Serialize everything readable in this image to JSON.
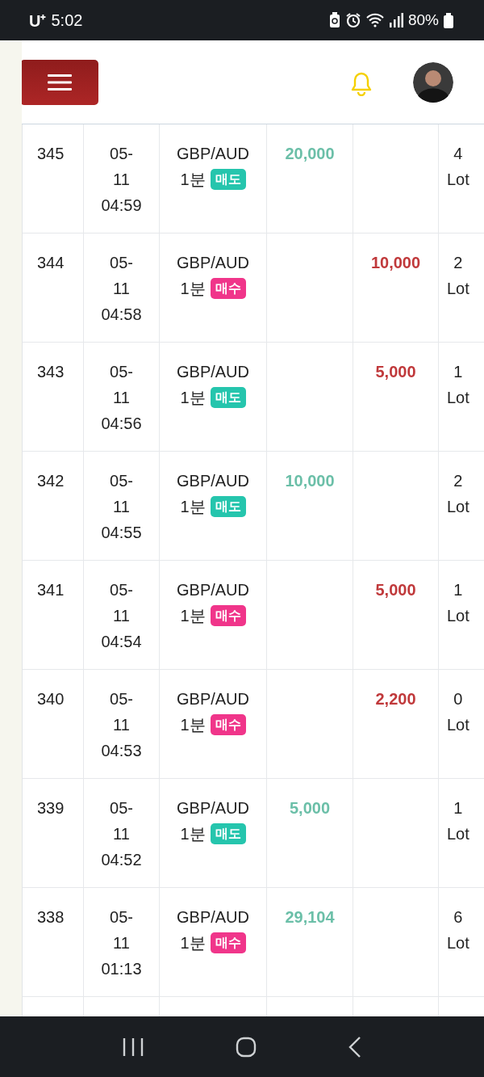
{
  "status_bar": {
    "carrier": "U⁺",
    "time": "5:02",
    "battery": "80%"
  },
  "table": {
    "rows": [
      {
        "id": "345",
        "date": "05-\n11\n04:59",
        "symbol": "GBP/AUD",
        "period": "1분",
        "side": {
          "kind": "sell",
          "label": "매도"
        },
        "profit": "20,000",
        "lot": "4\nLot"
      },
      {
        "id": "344",
        "date": "05-\n11\n04:58",
        "symbol": "GBP/AUD",
        "period": "1분",
        "side": {
          "kind": "buy",
          "label": "매수"
        },
        "loss": "10,000",
        "lot": "2\nLot"
      },
      {
        "id": "343",
        "date": "05-\n11\n04:56",
        "symbol": "GBP/AUD",
        "period": "1분",
        "side": {
          "kind": "sell",
          "label": "매도"
        },
        "loss": "5,000",
        "lot": "1\nLot"
      },
      {
        "id": "342",
        "date": "05-\n11\n04:55",
        "symbol": "GBP/AUD",
        "period": "1분",
        "side": {
          "kind": "sell",
          "label": "매도"
        },
        "profit": "10,000",
        "lot": "2\nLot"
      },
      {
        "id": "341",
        "date": "05-\n11\n04:54",
        "symbol": "GBP/AUD",
        "period": "1분",
        "side": {
          "kind": "buy",
          "label": "매수"
        },
        "loss": "5,000",
        "lot": "1\nLot"
      },
      {
        "id": "340",
        "date": "05-\n11\n04:53",
        "symbol": "GBP/AUD",
        "period": "1분",
        "side": {
          "kind": "buy",
          "label": "매수"
        },
        "loss": "2,200",
        "lot": "0\nLot"
      },
      {
        "id": "339",
        "date": "05-\n11\n04:52",
        "symbol": "GBP/AUD",
        "period": "1분",
        "side": {
          "kind": "sell",
          "label": "매도"
        },
        "profit": "5,000",
        "lot": "1\nLot"
      },
      {
        "id": "338",
        "date": "05-\n11\n01:13",
        "symbol": "GBP/AUD",
        "period": "1분",
        "side": {
          "kind": "buy",
          "label": "매수"
        },
        "profit": "29,104",
        "lot": "6\nLot"
      }
    ]
  }
}
